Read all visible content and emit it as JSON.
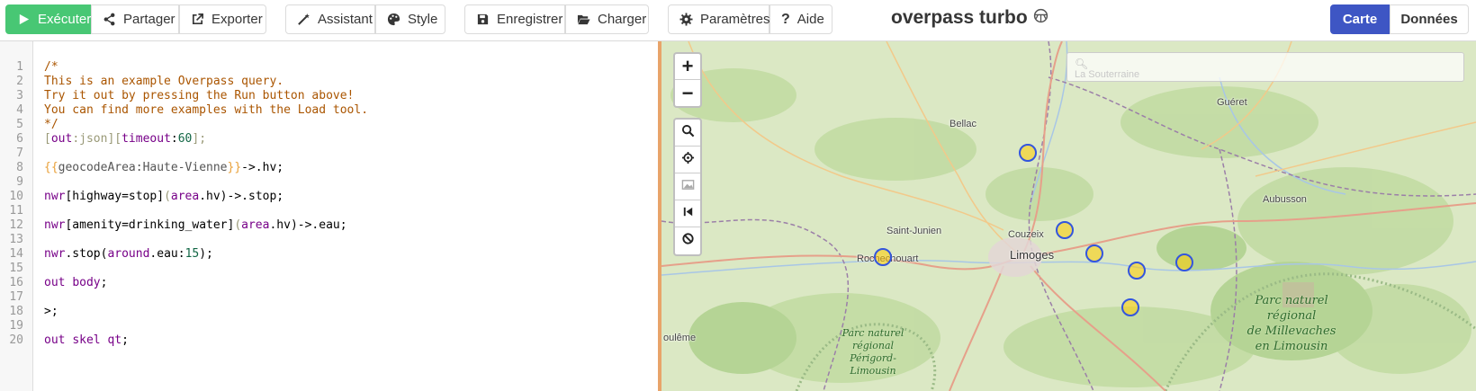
{
  "toolbar": {
    "run": "Exécuter",
    "share": "Partager",
    "export": "Exporter",
    "wizard": "Assistant",
    "style": "Style",
    "save": "Enregistrer",
    "load": "Charger",
    "settings": "Paramètres",
    "help": "Aide",
    "brand": "overpass turbo",
    "tab_map": "Carte",
    "tab_data": "Données"
  },
  "editor": {
    "line_numbers": [
      "1",
      "2",
      "3",
      "4",
      "5",
      "6",
      "7",
      "8",
      "9",
      "10",
      "11",
      "12",
      "13",
      "14",
      "15",
      "16",
      "17",
      "18",
      "19",
      "20"
    ],
    "lines": {
      "l1": "/*",
      "l2": "This is an example Overpass query.",
      "l3": "Try it out by pressing the Run button above!",
      "l4": "You can find more examples with the Load tool.",
      "l5": "*/",
      "l6_a": "[",
      "l6_b": "out",
      "l6_c": ":json][",
      "l6_d": "timeout",
      "l6_e": ":",
      "l6_f": "60",
      "l6_g": "];",
      "l8_a": "{{",
      "l8_b": "geocodeArea:Haute-Vienne",
      "l8_c": "}}",
      "l8_d": "->.hv;",
      "l10_a": "nwr",
      "l10_b": "[highway=stop]",
      "l10_c": "(",
      "l10_d": "area",
      "l10_e": ".hv)",
      "l10_f": "->.stop;",
      "l12_a": "nwr",
      "l12_b": "[amenity=drinking_water]",
      "l12_c": "(",
      "l12_d": "area",
      "l12_e": ".hv)",
      "l12_f": "->.eau;",
      "l14_a": "nwr",
      "l14_b": ".stop(",
      "l14_c": "around",
      "l14_d": ".eau:",
      "l14_e": "15",
      "l14_f": ");",
      "l16_a": "out",
      "l16_b": "body",
      "l16_c": ";",
      "l18": ">;",
      "l20_a": "out",
      "l20_b": "skel",
      "l20_c": "qt",
      "l20_d": ";"
    }
  },
  "map": {
    "search_placeholder": "La Souterraine",
    "zoom_in": "+",
    "zoom_out": "−",
    "places": {
      "bellac": "Bellac",
      "gueret": "Guéret",
      "aubusson": "Aubusson",
      "saint_junien": "Saint-Junien",
      "couzeix": "Couzeix",
      "limoges": "Limoges",
      "rochechouart": "Rochechouart",
      "angouleme": "oulême"
    },
    "parks": {
      "millevaches": "Parc naturel\nrégional\nde Millevaches\nen Limousin",
      "perigord": "Parc naturel\nrégional\nPérigord-\nLimousin"
    },
    "markers_count": 7,
    "colors": {
      "marker_stroke": "#3355dd",
      "marker_fill": "#ffcc00"
    }
  },
  "colors": {
    "run_button": "#48c774",
    "active_tab": "#3e56c4",
    "splitter": "#e8a46a",
    "comment": "#aa5500",
    "keyword": "#770088"
  }
}
